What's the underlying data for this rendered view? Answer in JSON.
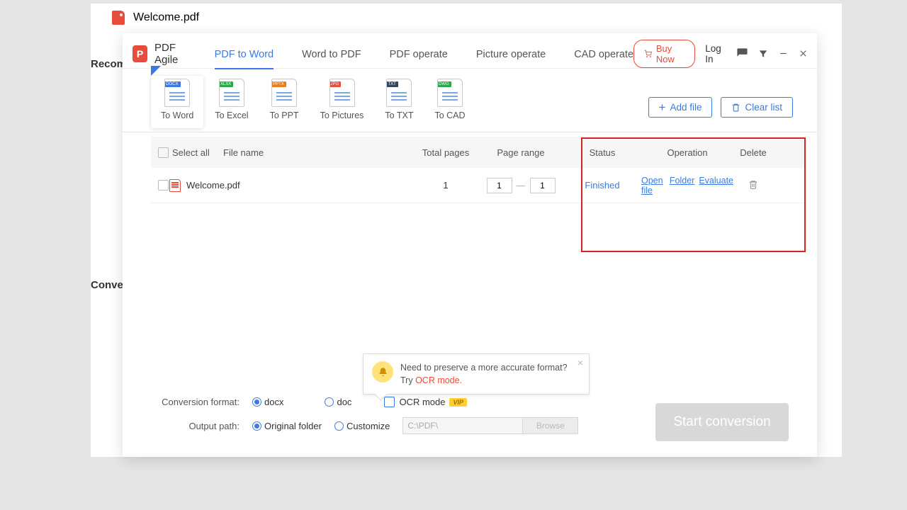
{
  "bgTab": {
    "filename": "Welcome.pdf"
  },
  "bgSections": {
    "recom": "Recom",
    "convert": "Conver"
  },
  "app": {
    "name": "PDF Agile",
    "logo_letter": "P"
  },
  "tabs": [
    {
      "label": "PDF to Word",
      "active": true
    },
    {
      "label": "Word to PDF"
    },
    {
      "label": "PDF operate"
    },
    {
      "label": "Picture operate"
    },
    {
      "label": "CAD operate"
    }
  ],
  "header": {
    "buy_now": "Buy Now",
    "log_in": "Log In"
  },
  "formats": [
    {
      "label": "To Word",
      "badge": "DOCX",
      "badge_color": "#3b7ae2",
      "selected": true
    },
    {
      "label": "To Excel",
      "badge": "XLSX",
      "badge_color": "#2ba84a"
    },
    {
      "label": "To PPT",
      "badge": "PPTX",
      "badge_color": "#e67e22"
    },
    {
      "label": "To Pictures",
      "badge": "JPG",
      "badge_color": "#e74c3c"
    },
    {
      "label": "To TXT",
      "badge": "TXT",
      "badge_color": "#34495e"
    },
    {
      "label": "To CAD",
      "badge": "DWG",
      "badge_color": "#2ba84a"
    }
  ],
  "toolbar": {
    "add_file": "Add file",
    "clear_list": "Clear list"
  },
  "table": {
    "headers": {
      "select_all": "Select all",
      "file_name": "File name",
      "total_pages": "Total pages",
      "page_range": "Page range",
      "status": "Status",
      "operation": "Operation",
      "delete": "Delete"
    },
    "rows": [
      {
        "file_name": "Welcome.pdf",
        "total_pages": "1",
        "range_from": "1",
        "range_to": "1",
        "status": "Finished",
        "ops": {
          "open_file": "Open file",
          "folder": "Folder",
          "evaluate": "Evaluate"
        }
      }
    ]
  },
  "tooltip": {
    "line1": "Need to preserve a more accurate format?",
    "line2_prefix": "Try ",
    "ocr_link": "OCR mode."
  },
  "footer": {
    "format_label": "Conversion format:",
    "docx": "docx",
    "doc": "doc",
    "ocr_mode": "OCR mode",
    "vip": "VIP",
    "path_label": "Output path:",
    "original": "Original folder",
    "customize": "Customize",
    "path_value": "C:\\PDF\\",
    "browse": "Browse",
    "start": "Start conversion"
  }
}
